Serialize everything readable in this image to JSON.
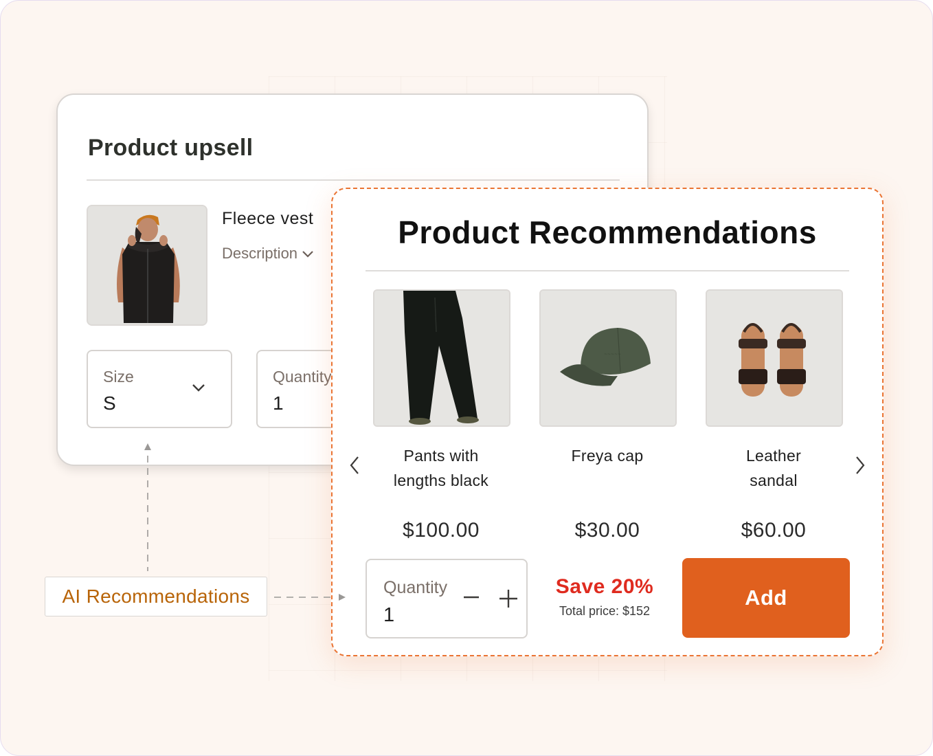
{
  "upsell": {
    "title": "Product upsell",
    "product_name": "Fleece vest",
    "description_label": "Description",
    "size_label": "Size",
    "size_value": "S",
    "quantity_label": "Quantity",
    "quantity_value": "1"
  },
  "recommendations": {
    "title": "Product Recommendations",
    "items": [
      {
        "name": "Pants with\nlengths black",
        "price": "$100.00"
      },
      {
        "name": "Freya cap",
        "price": "$30.00"
      },
      {
        "name": "Leather\nsandal",
        "price": "$60.00"
      }
    ],
    "quantity_label": "Quantity",
    "quantity_value": "1",
    "save_label": "Save 20%",
    "total_label": "Total price: $152",
    "add_label": "Add"
  },
  "ai_label": "AI Recommendations",
  "colors": {
    "accent": "#e0601e",
    "save_red": "#df2b1f",
    "ai_label_text": "#b86408",
    "dashed_border": "#ea7433"
  },
  "icons": [
    "chevron-down-icon",
    "chevron-left-icon",
    "chevron-right-icon",
    "minus-icon",
    "plus-icon",
    "arrow-up-icon",
    "arrow-right-icon"
  ]
}
